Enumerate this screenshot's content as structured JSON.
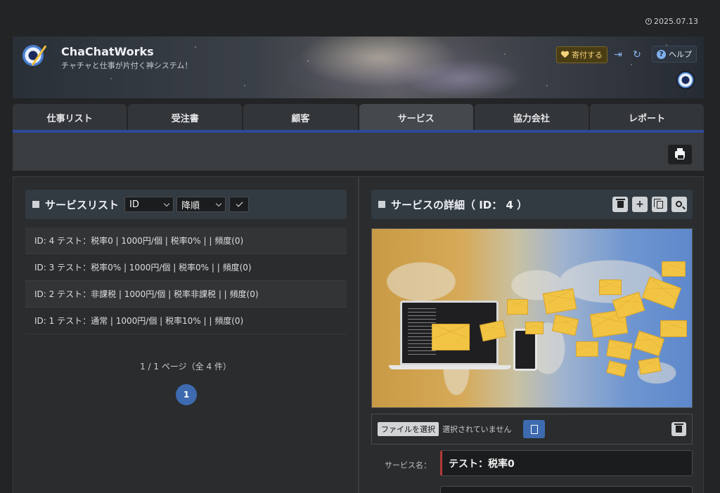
{
  "date": "2025.07.13",
  "brand": {
    "title": "ChaChatWorks",
    "subtitle": "チャチャと仕事が片付く神システム！"
  },
  "header": {
    "donate_label": "寄付する",
    "help_label": "ヘルプ"
  },
  "tabs": [
    "仕事リスト",
    "受注書",
    "顧客",
    "サービス",
    "協力会社",
    "レポート"
  ],
  "active_tab": 3,
  "list_panel": {
    "title": "サービスリスト",
    "sort_field": "ID",
    "sort_order": "降順",
    "rows": [
      "ID: 4 テスト：税率0 | 1000円/個 | 税率0% | | 頻度(0)",
      "ID: 3 テスト：税率0% | 1000円/個 | 税率0% | | 頻度(0)",
      "ID: 2 テスト：非課税 | 1000円/個 | 税率非課税 | | 頻度(0)",
      "ID: 1 テスト：通常 | 1000円/個 | 税率10% | | 頻度(0)"
    ],
    "page_info": "1 / 1 ページ（全 4 件）",
    "current_page": "1"
  },
  "detail_panel": {
    "title": "サービスの詳細（ ID： 4 ）",
    "file_button": "ファイルを選択",
    "file_status": "選択されていません",
    "name_label": "サービス名：",
    "name_value": "テスト：税率0"
  },
  "colors": {
    "accent": "#3e6bb0",
    "tab_line": "#2f4a9a",
    "donate": "#f3d27a",
    "required": "#b33a3a"
  }
}
